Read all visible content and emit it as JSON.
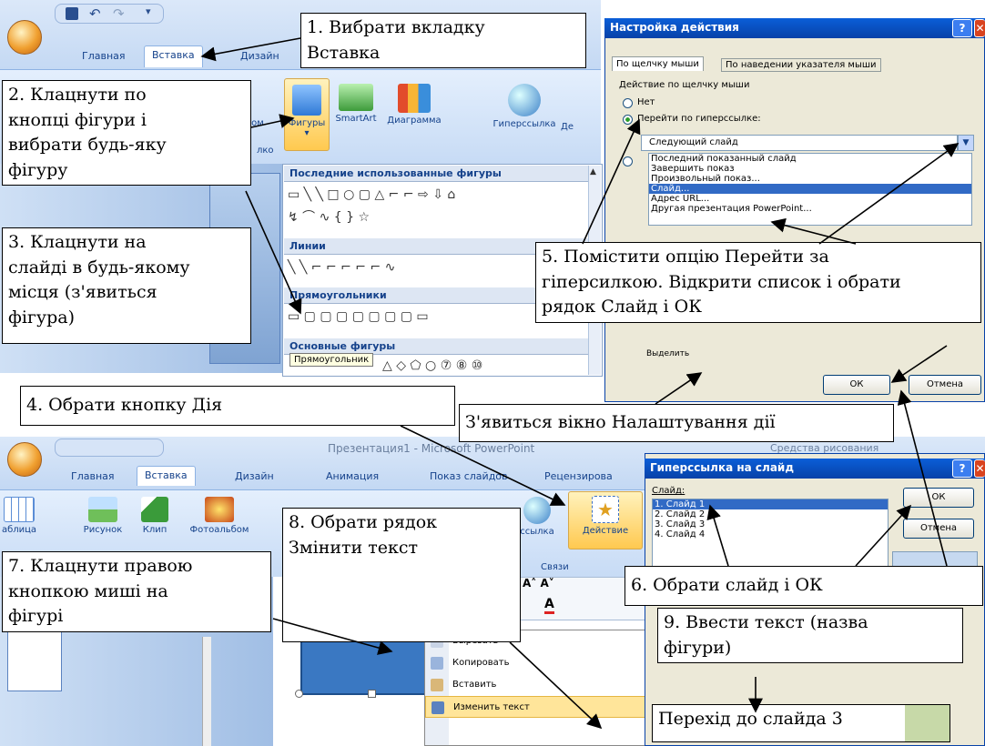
{
  "top_ribbon": {
    "tabs": [
      "Главная",
      "Вставка",
      "Дизайн"
    ],
    "groups": [
      "бом",
      "Фигуры",
      "SmartArt",
      "Диаграмма",
      "Гиперссылка",
      "Де"
    ],
    "truncated": "лко"
  },
  "shapes_gallery": {
    "recent_header": "Последние использованные фигуры",
    "recent_row1": "▭ ╲ ╲ □ ○ ▢ △ ⌐ ⌐ ⇨ ⇩ ⌂",
    "recent_row2": "↯ ⌒ ∿ { } ☆",
    "lines_header": "Линии",
    "lines_row": "╲ ╲ ⌐ ⌐ ⌐ ⌐ ⌐ ∿",
    "rect_header": "Прямоугольники",
    "rect_row": "▭ ▢ ▢ ▢ ▢ ▢ ▢ ▢ ▭",
    "basic_header": "Основные фигуры",
    "basic_row": "△ ◇ ⬠ ○ ⑦ ⑧ ⑩",
    "tooltip": "Прямоугольник"
  },
  "action_dialog": {
    "title": "Настройка действия",
    "tab1": "По щелчку мыши",
    "tab2": "По наведении указателя мыши",
    "group": "Действие по щелчку мыши",
    "opt_none": "Нет",
    "opt_link": "Перейти по гиперссылке:",
    "combo_value": "Следующий слайд",
    "list": [
      "Последний показанный слайд",
      "Завершить показ",
      "Произвольный показ...",
      "Слайд...",
      "Адрес URL...",
      "Другая презентация PowerPoint..."
    ],
    "ok": "ОК",
    "cancel": "Отмена",
    "hidden_label": "Выделить"
  },
  "bottom_ribbon": {
    "title": "Презентация1 - Microsoft PowerPoint",
    "context": "Средства рисования",
    "tabs": [
      "Главная",
      "Вставка",
      "Дизайн",
      "Анимация",
      "Показ слайдов",
      "Рецензирова"
    ],
    "groups": [
      "аблица",
      "Рисунок",
      "Клип",
      "Фотоальбом",
      "ссылка",
      "Действие"
    ],
    "group_label": "Связи"
  },
  "hyperlink_dialog": {
    "title": "Гиперссылка на слайд",
    "label": "Слайд:",
    "list": [
      "1. Слайд 1",
      "2. Слайд 2",
      "3. Слайд 3",
      "4. Слайд 4"
    ],
    "ok": "ОК",
    "cancel": "Отмена"
  },
  "context_menu": {
    "items": [
      "Вырезать",
      "Копировать",
      "Вставить",
      "Изменить текст"
    ]
  },
  "annotations": {
    "a1_line1": "1. Вибрати вкладку",
    "a1_line2": "Вставка",
    "a2_line1": "2. Клацнути по",
    "a2_line2": "кнопці фігури і",
    "a2_line3": "вибрати будь-яку",
    "a2_line4": "фігуру",
    "a3_line1": "3. Клацнути на",
    "a3_line2": "слайді в будь-якому",
    "a3_line3": "місця (з'явиться",
    "a3_line4": "фігура)",
    "a4": "4. Обрати кнопку Дія",
    "a5_line1": "5. Помістити опцію Перейти за",
    "a5_line2": "гіперсилкою. Відкрити список і обрати",
    "a5_line3": "рядок Слайд і ОК",
    "a_window": "З'явиться вікно Налаштування дії",
    "a6": "6. Обрати слайд і ОК",
    "a7_line1": "7. Клацнути правою",
    "a7_line2": "кнопкою миші на",
    "a7_line3": "фігурі",
    "a8_line1": "8. Обрати рядок",
    "a8_line2": "Змінити текст",
    "a9_line1": "9. Ввести текст (назва",
    "a9_line2": "фігури)",
    "result": "Перехід до слайда 3"
  }
}
